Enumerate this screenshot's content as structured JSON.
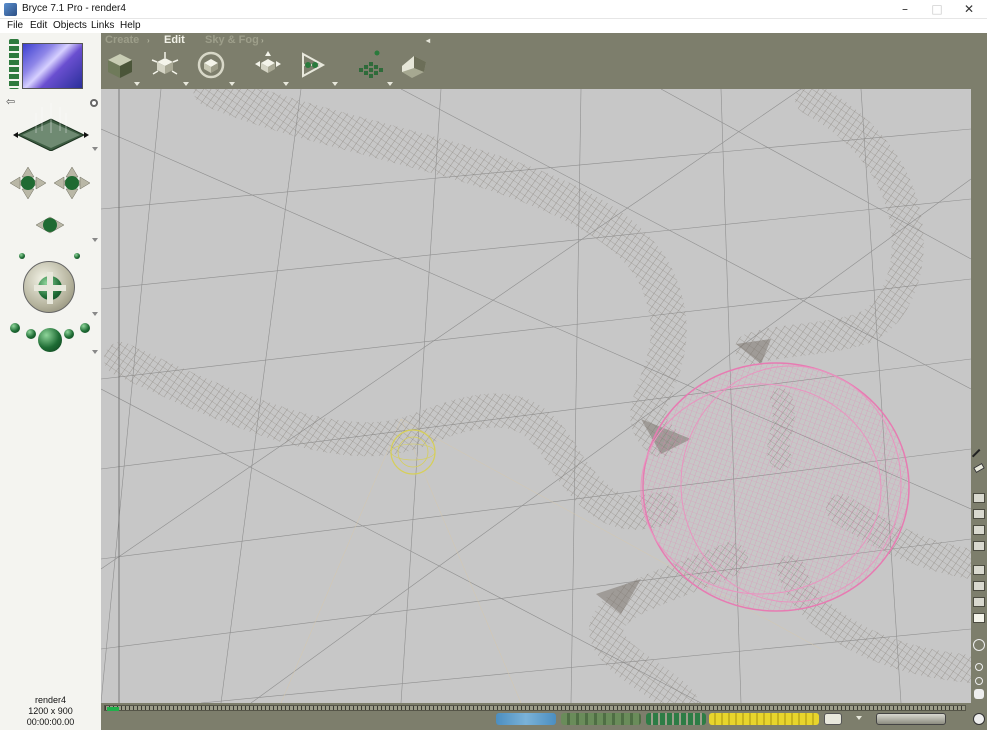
{
  "window": {
    "title": "Bryce 7.1  Pro - render4"
  },
  "menu": [
    "File",
    "Edit",
    "Objects",
    "Links",
    "Help"
  ],
  "palette_tabs": {
    "create": "Create",
    "edit": "Edit",
    "sky_fog": "Sky & Fog"
  },
  "document": {
    "name": "render4",
    "size": "1200 x 900",
    "time": "00:00:00.00"
  },
  "colors": {
    "toolbar": "#7d7e6c",
    "viewport": "#c7c7c7",
    "sphere_wire": "#e77bb2",
    "selection": "#d6cf5a",
    "tube_wire": "#8a8580"
  }
}
